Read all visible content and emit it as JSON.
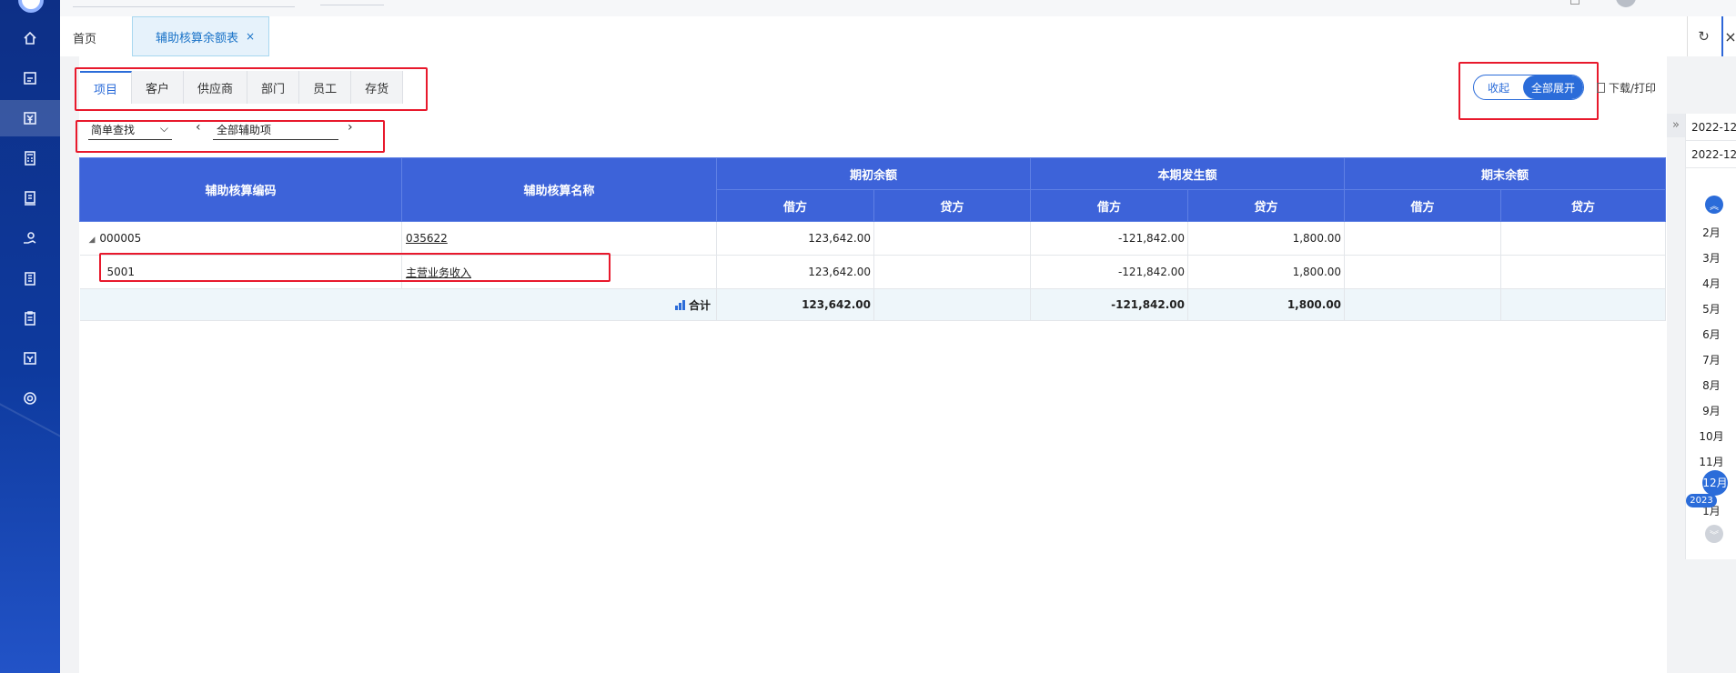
{
  "tabs": {
    "home": "首页",
    "active": "辅助核算余额表",
    "close": "×"
  },
  "subtabs": [
    "项目",
    "客户",
    "供应商",
    "部门",
    "员工",
    "存货"
  ],
  "filter": {
    "mode": "简单查找",
    "aux_item": "全部辅助项",
    "prev": "‹",
    "next": "›"
  },
  "toggle": {
    "collapse": "收起",
    "expand": "全部展开"
  },
  "download": "下载/打印",
  "table": {
    "headers": {
      "code": "辅助核算编码",
      "name": "辅助核算名称",
      "opening": "期初余额",
      "period": "本期发生额",
      "closing": "期末余额",
      "debit": "借方",
      "credit": "贷方"
    },
    "rows": [
      {
        "code": "000005",
        "name": "035622",
        "open_debit": "123,642.00",
        "open_credit": "",
        "period_debit": "-121,842.00",
        "period_credit": "1,800.00",
        "close_debit": "",
        "close_credit": ""
      },
      {
        "code": "5001",
        "name": "主营业务收入",
        "open_debit": "123,642.00",
        "open_credit": "",
        "period_debit": "-121,842.00",
        "period_credit": "1,800.00",
        "close_debit": "",
        "close_credit": ""
      }
    ],
    "total": {
      "label": "合计",
      "open_debit": "123,642.00",
      "open_credit": "",
      "period_debit": "-121,842.00",
      "period_credit": "1,800.00",
      "close_debit": "",
      "close_credit": ""
    }
  },
  "period": {
    "start": "2022-12",
    "end": "2022-12",
    "months": [
      "2月",
      "3月",
      "4月",
      "5月",
      "6月",
      "7月",
      "8月",
      "9月",
      "10月",
      "11月",
      "12月",
      "1月"
    ],
    "current": "12月",
    "year": "2023"
  },
  "colors": {
    "accent": "#2b6cd9",
    "header": "#3d63d9",
    "highlight": "#e8192c"
  }
}
